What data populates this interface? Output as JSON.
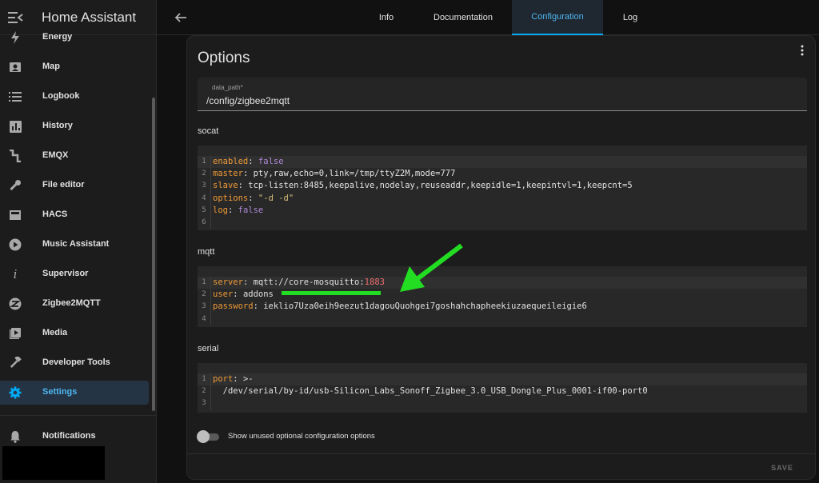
{
  "app": {
    "title": "Home Assistant"
  },
  "sidebar": {
    "items": [
      {
        "label": "Energy",
        "icon": "lightning-icon"
      },
      {
        "label": "Map",
        "icon": "map-icon"
      },
      {
        "label": "Logbook",
        "icon": "list-icon"
      },
      {
        "label": "History",
        "icon": "chart-icon"
      },
      {
        "label": "EMQX",
        "icon": "emqx-icon"
      },
      {
        "label": "File editor",
        "icon": "wrench-icon"
      },
      {
        "label": "HACS",
        "icon": "hacs-icon"
      },
      {
        "label": "Music Assistant",
        "icon": "play-icon"
      },
      {
        "label": "Supervisor",
        "icon": "info-icon"
      },
      {
        "label": "Zigbee2MQTT",
        "icon": "zigbee-icon"
      },
      {
        "label": "Media",
        "icon": "media-icon"
      },
      {
        "label": "Developer Tools",
        "icon": "hammer-icon"
      },
      {
        "label": "Settings",
        "icon": "gear-icon",
        "active": true
      },
      {
        "label": "Notifications",
        "icon": "bell-icon"
      }
    ]
  },
  "tabs": [
    {
      "label": "Info"
    },
    {
      "label": "Documentation"
    },
    {
      "label": "Configuration",
      "active": true
    },
    {
      "label": "Log"
    }
  ],
  "card": {
    "title": "Options",
    "data_path": {
      "label": "data_path*",
      "value": "/config/zigbee2mqtt"
    },
    "sections": {
      "socat": "socat",
      "mqtt": "mqtt",
      "serial": "serial"
    },
    "toggle_label": "Show unused optional configuration options",
    "save_label": "SAVE"
  },
  "code": {
    "socat": {
      "line_numbers": [
        "1",
        "2",
        "3",
        "4",
        "5",
        "6"
      ],
      "l1k": "enabled",
      "l1v": "false",
      "l2k": "master",
      "l2v": "pty,raw,echo=0,link=/tmp/ttyZ2M,mode=777",
      "l3k": "slave",
      "l3v": "tcp-listen:8485,keepalive,nodelay,reuseaddr,keepidle=1,keepintvl=1,keepcnt=5",
      "l4k": "options",
      "l4v": "\"-d -d\"",
      "l5k": "log",
      "l5v": "false"
    },
    "mqtt": {
      "line_numbers": [
        "1",
        "2",
        "3",
        "4"
      ],
      "l1k": "server",
      "l1v": "mqtt://core-mosquitto:",
      "l1port": "1883",
      "l2k": "user",
      "l2v": "addons",
      "l3k": "password",
      "l3v": "ieklio7Uza0eih9eezut1dagouQuohgei7goshahchapheekiuzaequeileigie6"
    },
    "serial": {
      "line_numbers": [
        "1",
        "2",
        "3"
      ],
      "l1k": "port",
      "l1v": ">-",
      "l2v": "  /dev/serial/by-id/usb-Silicon_Labs_Sonoff_Zigbee_3.0_USB_Dongle_Plus_0001-if00-port0"
    }
  },
  "colors": {
    "accent": "#03a9f4",
    "annotation": "#22dd22",
    "key": "#ef9a38",
    "bool": "#b088d8"
  }
}
